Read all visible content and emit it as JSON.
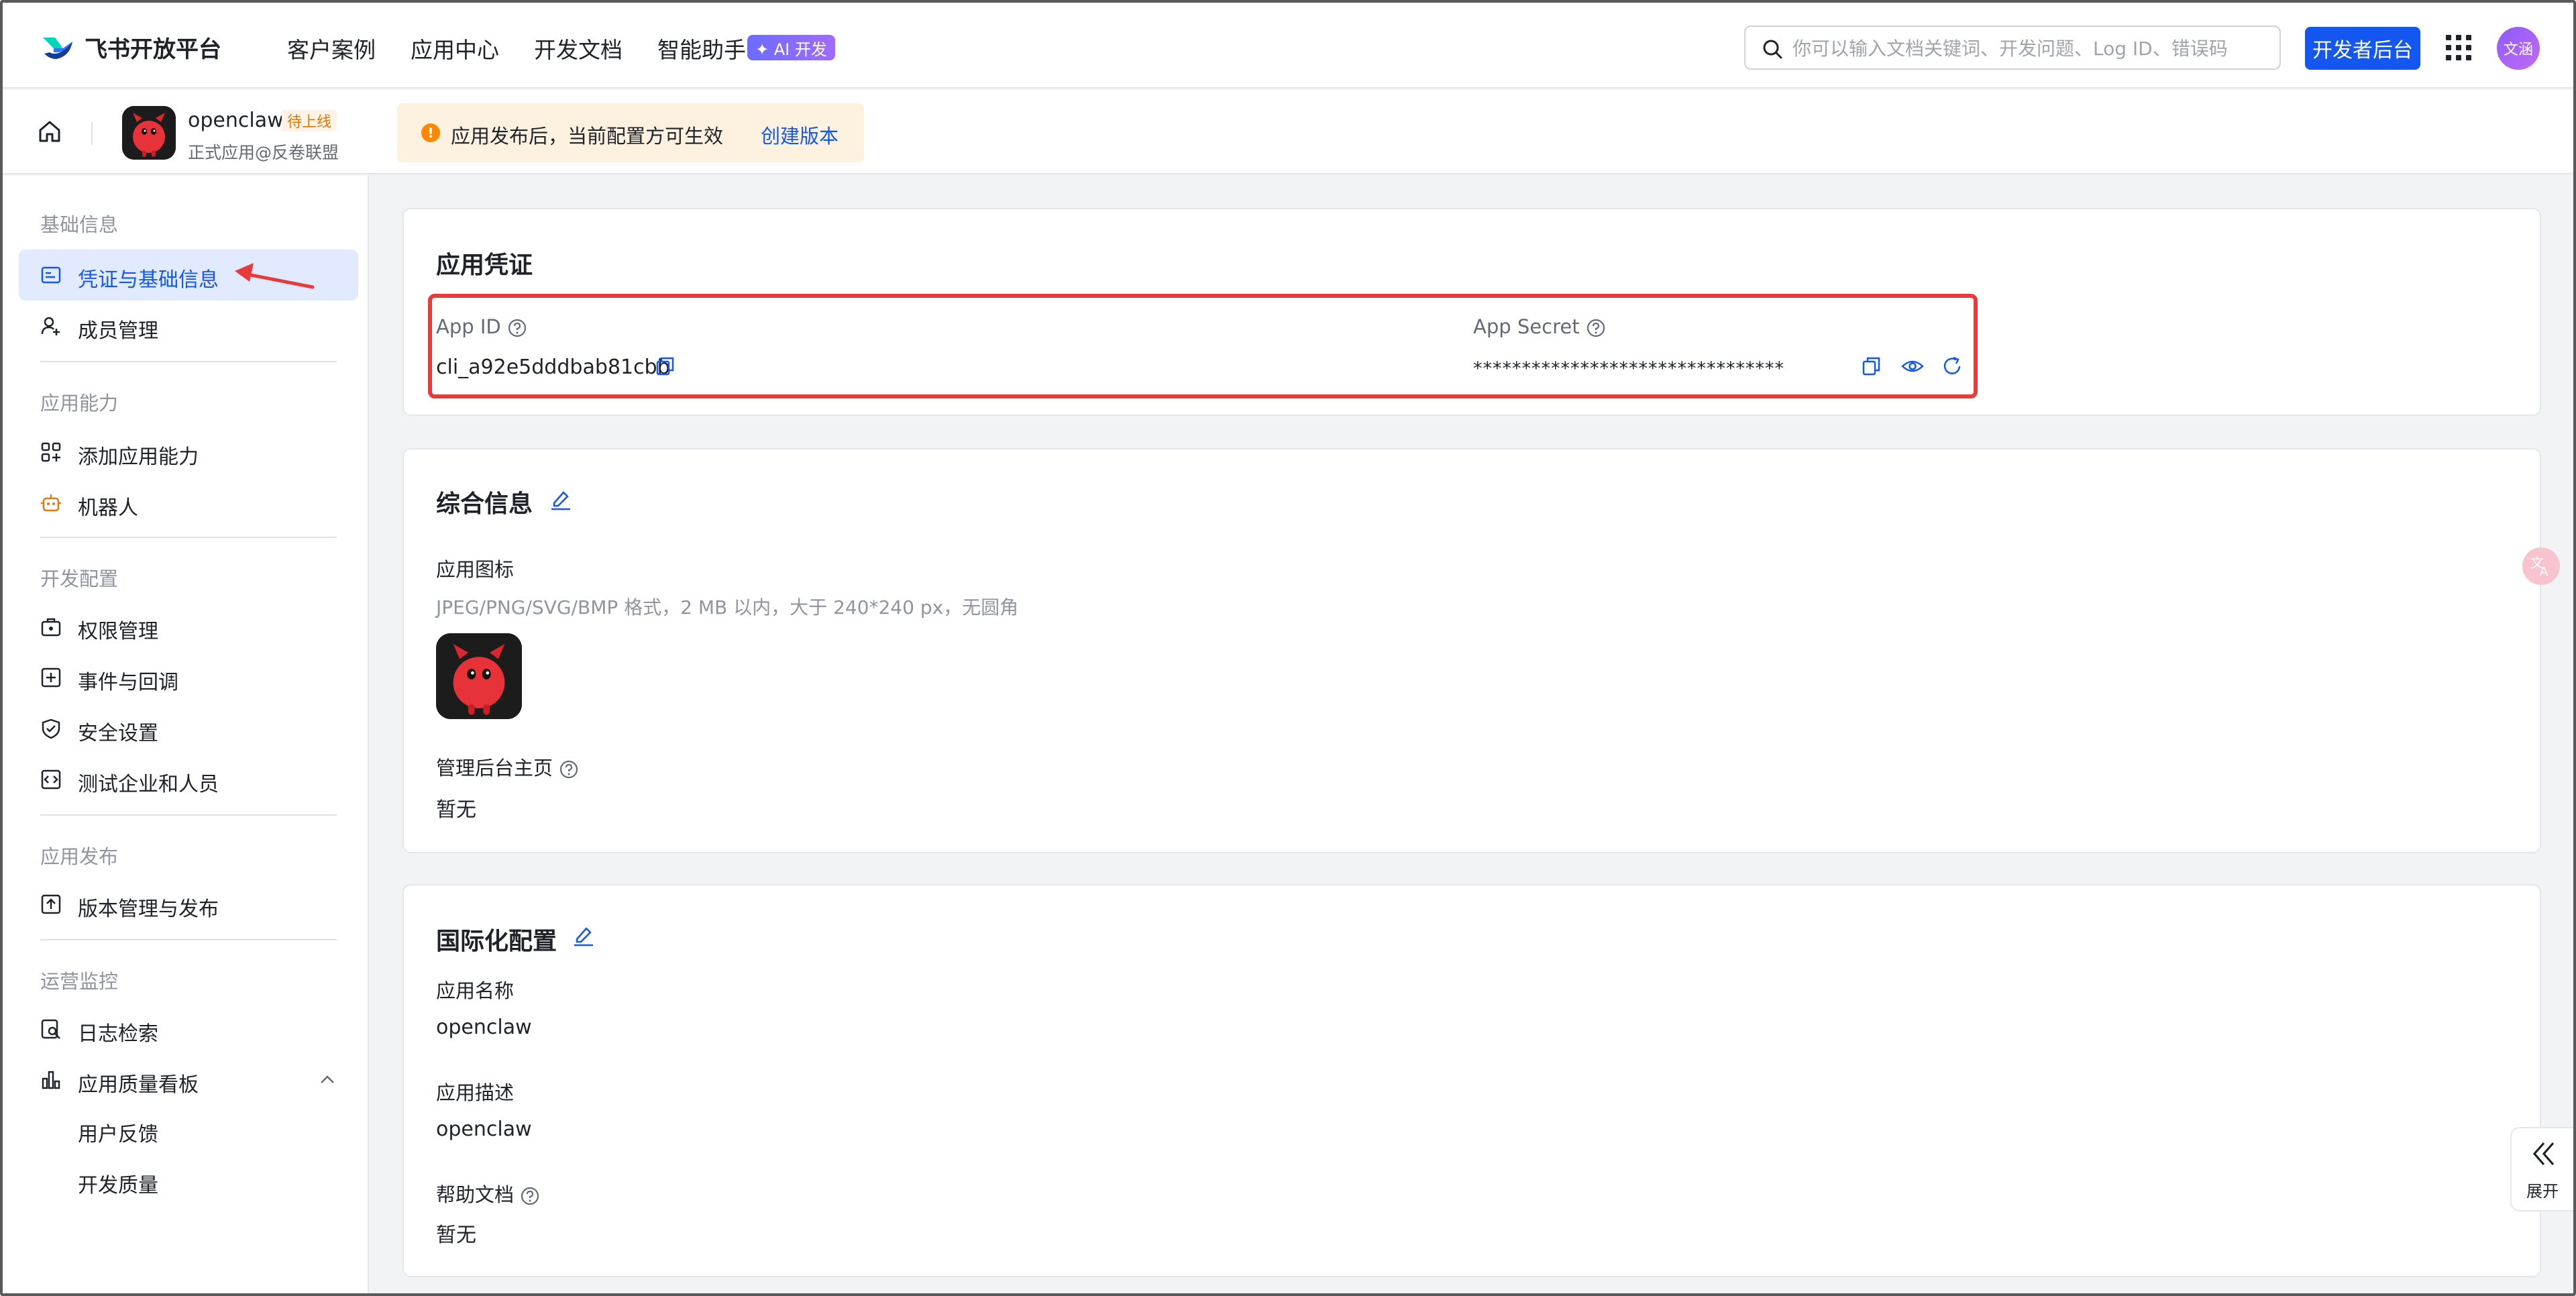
{
  "topnav": {
    "logo_text": "飞书开放平台",
    "items": [
      "客户案例",
      "应用中心",
      "开发文档",
      "智能助手"
    ],
    "ai_badge": "✦ AI 开发",
    "search_placeholder": "你可以输入文档关键词、开发问题、Log ID、错误码",
    "dev_button": "开发者后台",
    "avatar_text": "文涵"
  },
  "subheader": {
    "app_name": "openclaw",
    "status_tag": "待上线",
    "app_subtitle": "正式应用@反卷联盟",
    "notice_text": "应用发布后，当前配置方可生效",
    "notice_link": "创建版本"
  },
  "sidebar": {
    "sections": [
      {
        "title": "基础信息",
        "items": [
          "凭证与基础信息",
          "成员管理"
        ]
      },
      {
        "title": "应用能力",
        "items": [
          "添加应用能力",
          "机器人"
        ]
      },
      {
        "title": "开发配置",
        "items": [
          "权限管理",
          "事件与回调",
          "安全设置",
          "测试企业和人员"
        ]
      },
      {
        "title": "应用发布",
        "items": [
          "版本管理与发布"
        ]
      },
      {
        "title": "运营监控",
        "items": [
          "日志检索",
          "应用质量看板"
        ]
      }
    ],
    "sub_items": [
      "用户反馈",
      "开发质量"
    ],
    "active_item": "凭证与基础信息"
  },
  "credentials": {
    "title": "应用凭证",
    "app_id_label": "App ID",
    "app_id_value": "cli_a92e5dddbab81cbb",
    "app_secret_label": "App Secret",
    "app_secret_value": "********************************"
  },
  "general_info": {
    "title": "综合信息",
    "icon_label": "应用图标",
    "icon_hint": "JPEG/PNG/SVG/BMP 格式，2 MB 以内，大于 240*240 px，无圆角",
    "homepage_label": "管理后台主页",
    "homepage_value": "暂无"
  },
  "i18n": {
    "title": "国际化配置",
    "name_label": "应用名称",
    "name_value": "openclaw",
    "desc_label": "应用描述",
    "desc_value": "openclaw",
    "help_label": "帮助文档",
    "help_value": "暂无"
  },
  "float_panel": {
    "label": "展开"
  },
  "colors": {
    "brand_blue": "#1456f0",
    "highlight_red": "#e83a3a",
    "active_bg": "#e1eaff"
  }
}
